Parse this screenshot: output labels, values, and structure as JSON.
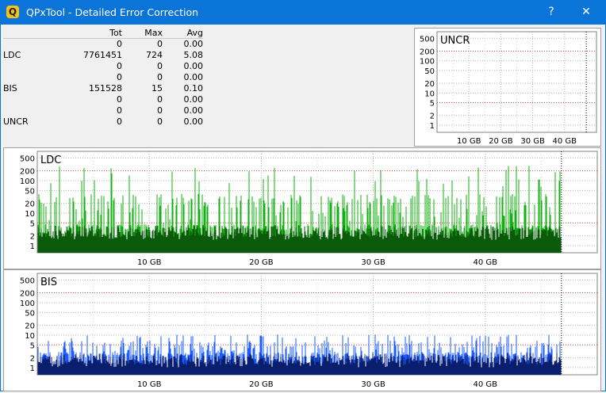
{
  "window": {
    "title": "QPxTool - Detailed Error Correction",
    "help_label": "?",
    "close_label": "✕",
    "app_icon_letter": "Q"
  },
  "stats": {
    "headers": [
      "Tot",
      "Max",
      "Avg"
    ],
    "rows": [
      {
        "label": "",
        "tot": "0",
        "max": "0",
        "avg": "0.00"
      },
      {
        "label": "LDC",
        "tot": "7761451",
        "max": "724",
        "avg": "5.08"
      },
      {
        "label": "",
        "tot": "0",
        "max": "0",
        "avg": "0.00"
      },
      {
        "label": "",
        "tot": "0",
        "max": "0",
        "avg": "0.00"
      },
      {
        "label": "BIS",
        "tot": "151528",
        "max": "15",
        "avg": "0.10"
      },
      {
        "label": "",
        "tot": "0",
        "max": "0",
        "avg": "0.00"
      },
      {
        "label": "",
        "tot": "0",
        "max": "0",
        "avg": "0.00"
      },
      {
        "label": "UNCR",
        "tot": "0",
        "max": "0",
        "avg": "0.00"
      }
    ]
  },
  "chart_data": [
    {
      "type": "bar",
      "title": "UNCR",
      "y_scale": "log",
      "y_ticks": [
        "500",
        "200",
        "100",
        "50",
        "20",
        "10",
        "5",
        "2",
        "1"
      ],
      "x_ticks": [
        "10 GB",
        "20 GB",
        "30 GB",
        "40 GB"
      ],
      "x_range_gb": [
        0,
        50
      ],
      "end_marker_gb": 46.8,
      "values": [],
      "series": [
        {
          "name": "UNCR",
          "color": "#00c000",
          "values": []
        }
      ]
    },
    {
      "type": "bar",
      "title": "LDC",
      "y_scale": "log",
      "y_ticks": [
        "500",
        "200",
        "100",
        "50",
        "20",
        "10",
        "5",
        "2",
        "1"
      ],
      "x_ticks": [
        "10 GB",
        "20 GB",
        "30 GB",
        "40 GB"
      ],
      "x_range_gb": [
        0,
        50
      ],
      "end_marker_gb": 46.8,
      "max": 724,
      "series": [
        {
          "name": "LDC",
          "color": "#12b012",
          "dark_color": "#0a5a0a",
          "typical_peak": 60,
          "typical_base": 3
        }
      ]
    },
    {
      "type": "bar",
      "title": "BIS",
      "y_scale": "log",
      "y_ticks": [
        "500",
        "200",
        "100",
        "50",
        "20",
        "10",
        "5",
        "2",
        "1"
      ],
      "x_ticks": [
        "10 GB",
        "20 GB",
        "30 GB",
        "40 GB"
      ],
      "x_range_gb": [
        0,
        50
      ],
      "end_marker_gb": 46.8,
      "max": 15,
      "series": [
        {
          "name": "BIS",
          "color": "#1a5cff",
          "dark_color": "#0a1e6e",
          "typical_peak": 8,
          "typical_base": 2
        }
      ]
    }
  ]
}
